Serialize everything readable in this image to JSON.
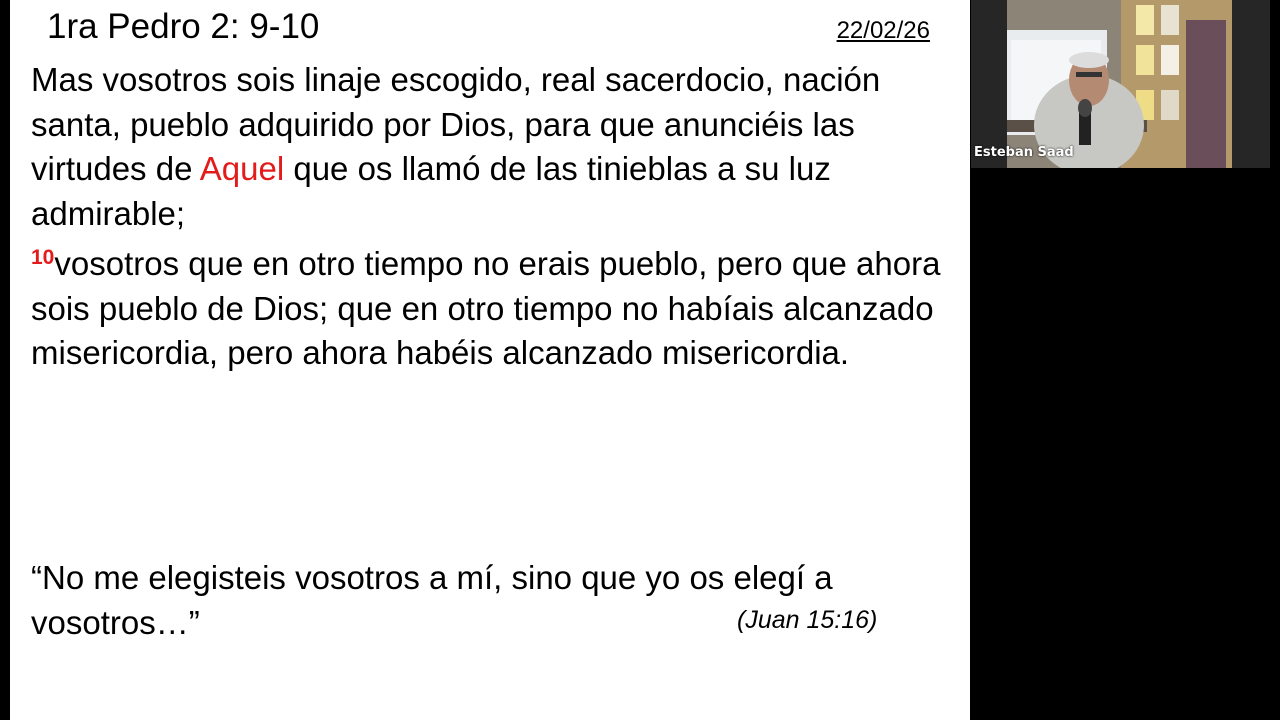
{
  "slide": {
    "title": "1ra Pedro 2: 9-10",
    "date": "22/02/26",
    "verse": {
      "part1": "Mas vosotros sois linaje escogido, real sacerdocio, nación santa, pueblo adquirido por Dios, para que anunciéis las virtudes de ",
      "highlight": "Aquel",
      "part2": " que os llamó de las tinieblas a su luz admirable;",
      "verse10_number": "10",
      "verse10_text": "vosotros que en otro tiempo no erais pueblo, pero que ahora sois pueblo de Dios; que en otro tiempo no habíais alcanzado misericordia, pero ahora habéis alcanzado misericordia."
    },
    "quote": {
      "text": "“No me elegisteis vosotros a mí, sino que yo os elegí a vosotros…”",
      "reference": "(Juan 15:16)"
    },
    "colors": {
      "highlight": "#e31b1b",
      "background": "#ffffff"
    }
  },
  "participant": {
    "name": "Esteban Saad"
  }
}
